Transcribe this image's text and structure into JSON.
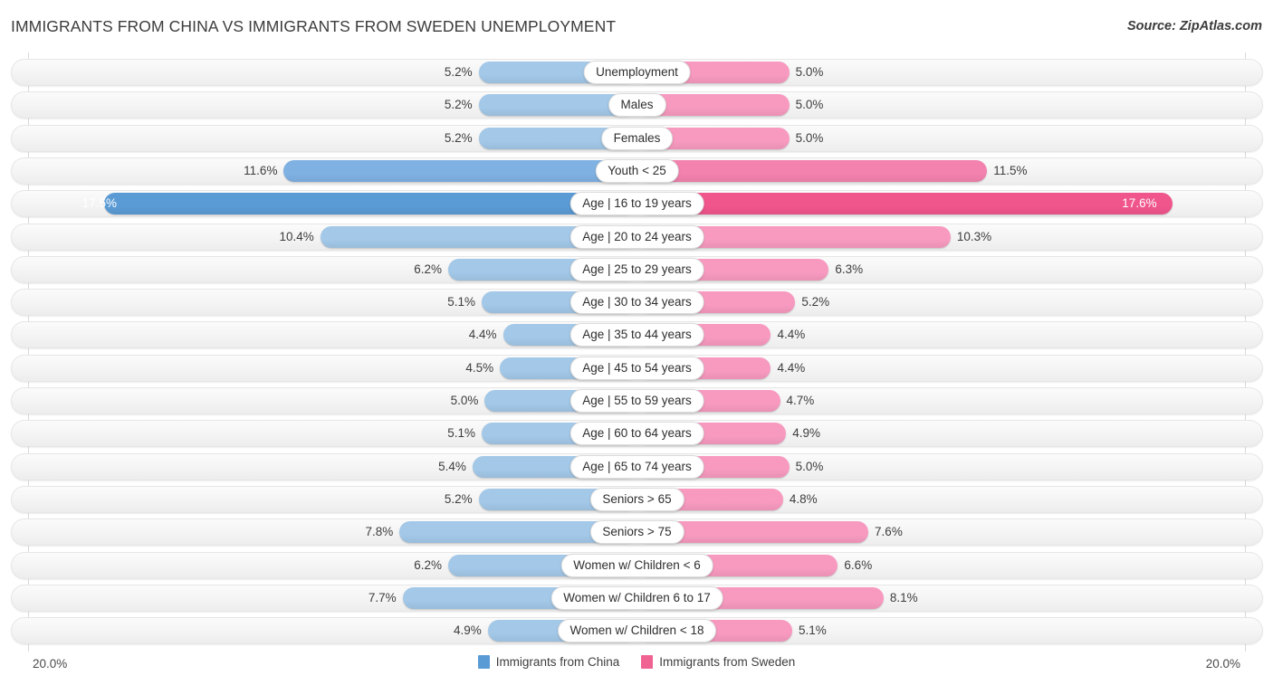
{
  "header": {
    "title": "IMMIGRANTS FROM CHINA VS IMMIGRANTS FROM SWEDEN UNEMPLOYMENT",
    "source": "Source: ZipAtlas.com"
  },
  "axis": {
    "left_max_label": "20.0%",
    "right_max_label": "20.0%",
    "max_value": 20.0
  },
  "legend": [
    {
      "label": "Immigrants from China",
      "color": "#5b9bd5"
    },
    {
      "label": "Immigrants from Sweden",
      "color": "#f06292"
    }
  ],
  "colors": {
    "left_light": "#a3c8e8",
    "left_mid": "#7fb1e3",
    "left_strong": "#5b9bd5",
    "right_light": "#f89ac0",
    "right_mid": "#f382ae",
    "right_strong": "#f0558c",
    "track": "#f4f4f4",
    "gridline": "#d9d9d9"
  },
  "chart_data": {
    "type": "bar",
    "subtype": "diverging-bidirectional",
    "title": "IMMIGRANTS FROM CHINA VS IMMIGRANTS FROM SWEDEN UNEMPLOYMENT",
    "xlabel": "",
    "ylabel": "",
    "xlim": [
      0,
      20
    ],
    "grid": true,
    "legend_position": "bottom-center",
    "units": "%",
    "categories": [
      "Unemployment",
      "Males",
      "Females",
      "Youth < 25",
      "Age | 16 to 19 years",
      "Age | 20 to 24 years",
      "Age | 25 to 29 years",
      "Age | 30 to 34 years",
      "Age | 35 to 44 years",
      "Age | 45 to 54 years",
      "Age | 55 to 59 years",
      "Age | 60 to 64 years",
      "Age | 65 to 74 years",
      "Seniors > 65",
      "Seniors > 75",
      "Women w/ Children < 6",
      "Women w/ Children 6 to 17",
      "Women w/ Children < 18"
    ],
    "series": [
      {
        "name": "Immigrants from China",
        "side": "left",
        "values": [
          5.2,
          5.2,
          5.2,
          11.6,
          17.5,
          10.4,
          6.2,
          5.1,
          4.4,
          4.5,
          5.0,
          5.1,
          5.4,
          5.2,
          7.8,
          6.2,
          7.7,
          4.9
        ]
      },
      {
        "name": "Immigrants from Sweden",
        "side": "right",
        "values": [
          5.0,
          5.0,
          5.0,
          11.5,
          17.6,
          10.3,
          6.3,
          5.2,
          4.4,
          4.4,
          4.7,
          4.9,
          5.0,
          4.8,
          7.6,
          6.6,
          8.1,
          5.1
        ]
      }
    ]
  },
  "rows": [
    {
      "label": "Unemployment",
      "left": "5.2%",
      "right": "5.0%",
      "lv": 5.2,
      "rv": 5.0,
      "hl": false
    },
    {
      "label": "Males",
      "left": "5.2%",
      "right": "5.0%",
      "lv": 5.2,
      "rv": 5.0,
      "hl": false
    },
    {
      "label": "Females",
      "left": "5.2%",
      "right": "5.0%",
      "lv": 5.2,
      "rv": 5.0,
      "hl": false
    },
    {
      "label": "Youth < 25",
      "left": "11.6%",
      "right": "11.5%",
      "lv": 11.6,
      "rv": 11.5,
      "hl": false
    },
    {
      "label": "Age | 16 to 19 years",
      "left": "17.5%",
      "right": "17.6%",
      "lv": 17.5,
      "rv": 17.6,
      "hl": true
    },
    {
      "label": "Age | 20 to 24 years",
      "left": "10.4%",
      "right": "10.3%",
      "lv": 10.4,
      "rv": 10.3,
      "hl": false
    },
    {
      "label": "Age | 25 to 29 years",
      "left": "6.2%",
      "right": "6.3%",
      "lv": 6.2,
      "rv": 6.3,
      "hl": false
    },
    {
      "label": "Age | 30 to 34 years",
      "left": "5.1%",
      "right": "5.2%",
      "lv": 5.1,
      "rv": 5.2,
      "hl": false
    },
    {
      "label": "Age | 35 to 44 years",
      "left": "4.4%",
      "right": "4.4%",
      "lv": 4.4,
      "rv": 4.4,
      "hl": false
    },
    {
      "label": "Age | 45 to 54 years",
      "left": "4.5%",
      "right": "4.4%",
      "lv": 4.5,
      "rv": 4.4,
      "hl": false
    },
    {
      "label": "Age | 55 to 59 years",
      "left": "5.0%",
      "right": "4.7%",
      "lv": 5.0,
      "rv": 4.7,
      "hl": false
    },
    {
      "label": "Age | 60 to 64 years",
      "left": "5.1%",
      "right": "4.9%",
      "lv": 5.1,
      "rv": 4.9,
      "hl": false
    },
    {
      "label": "Age | 65 to 74 years",
      "left": "5.4%",
      "right": "5.0%",
      "lv": 5.4,
      "rv": 5.0,
      "hl": false
    },
    {
      "label": "Seniors > 65",
      "left": "5.2%",
      "right": "4.8%",
      "lv": 5.2,
      "rv": 4.8,
      "hl": false
    },
    {
      "label": "Seniors > 75",
      "left": "7.8%",
      "right": "7.6%",
      "lv": 7.8,
      "rv": 7.6,
      "hl": false
    },
    {
      "label": "Women w/ Children < 6",
      "left": "6.2%",
      "right": "6.6%",
      "lv": 6.2,
      "rv": 6.6,
      "hl": false
    },
    {
      "label": "Women w/ Children 6 to 17",
      "left": "7.7%",
      "right": "8.1%",
      "lv": 7.7,
      "rv": 8.1,
      "hl": false
    },
    {
      "label": "Women w/ Children < 18",
      "left": "4.9%",
      "right": "5.1%",
      "lv": 4.9,
      "rv": 5.1,
      "hl": false
    }
  ]
}
